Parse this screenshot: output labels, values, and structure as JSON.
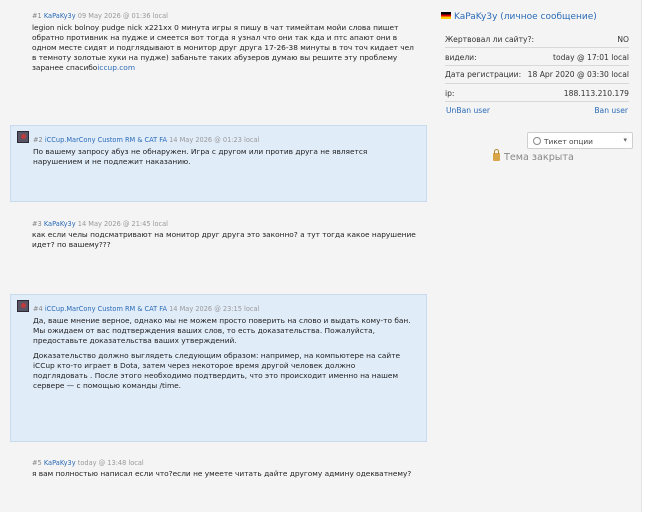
{
  "posts": [
    {
      "num": "#1",
      "user": "KaPaKy3y",
      "date": "09 May 2026 @ 01:36 local",
      "lines": [
        "legion nick bolnoy pudge nick x221xx 0 минута игры я пишу в чат тимейтам мойи слова пишет",
        "обратно противник на пудже и смеется вот тогда я узнал что они так кда и птс апают они в",
        "одном месте сидят и подглядывают в монитор друг друга 17-26-38 минуты в точ точ кидает чел",
        "в темноту золотые хуки на пудже) забаньте таких абузеров думаю вы решите эту проблему"
      ],
      "last_line_prefix": "заранее спасибо",
      "last_line_link": "iccup.com"
    },
    {
      "num": "#2",
      "user": "iCCup.MarCony Custom RM & CAT FA",
      "date": "14 May 2026 @ 01:23 local",
      "lines": [
        "По вашему запросу абуз не обнаружен. Игра с другом или против друга не является",
        "нарушением и не подлежит наказанию."
      ]
    },
    {
      "num": "#3",
      "user": "KaPaKy3y",
      "date": "14 May 2026 @ 21:45 local",
      "lines": [
        "как если челы подсматривают на монитор друг друга это законно? а тут тогда какое нарушение",
        "идет? по вашему???"
      ]
    },
    {
      "num": "#4",
      "user": "iCCup.MarCony Custom RM & CAT FA",
      "date": "14 May 2026 @ 23:15 local",
      "para1": [
        "Да, ваше мнение верное, однако мы не можем просто поверить на слово и выдать кому-то бан.",
        "Мы ожидаем от вас подтверждения ваших слов, то есть доказательства. Пожалуйста,",
        "предоставьте доказательства ваших утверждений."
      ],
      "para2": [
        "Доказательство должно выглядеть следующим образом: например, на компьютере на сайте",
        "iCCup кто-то играет в Dota, затем через некоторое время другой человек должно",
        "подглядовать . После этого необходимо подтвердить, что это происходит именно на нашем",
        "сервере — с помощью команды /time."
      ]
    },
    {
      "num": "#5",
      "user": "KaPaKy3y",
      "date": "today @ 13:48 local",
      "lines": [
        "я вам полностью написал если что?если не умеете читать дайте другому админу одекватнему?"
      ]
    }
  ],
  "sidebar": {
    "title": "KaPaKy3y (личное сообщение)",
    "rows": [
      {
        "key": "Жертвовал ли сайту?:",
        "value": "NO"
      },
      {
        "key": "видели:",
        "value": "today @ 17:01 local"
      },
      {
        "key": "Дата регистрации:",
        "value": "18 Apr 2020 @ 03:30 local"
      },
      {
        "key": "ip:",
        "value": "188.113.210.179"
      }
    ],
    "unban_label": "UnBan user",
    "ban_label": "Ban user",
    "ticket_options_label": "Тикет опции",
    "topic_closed_label": "Тема закрыта"
  }
}
